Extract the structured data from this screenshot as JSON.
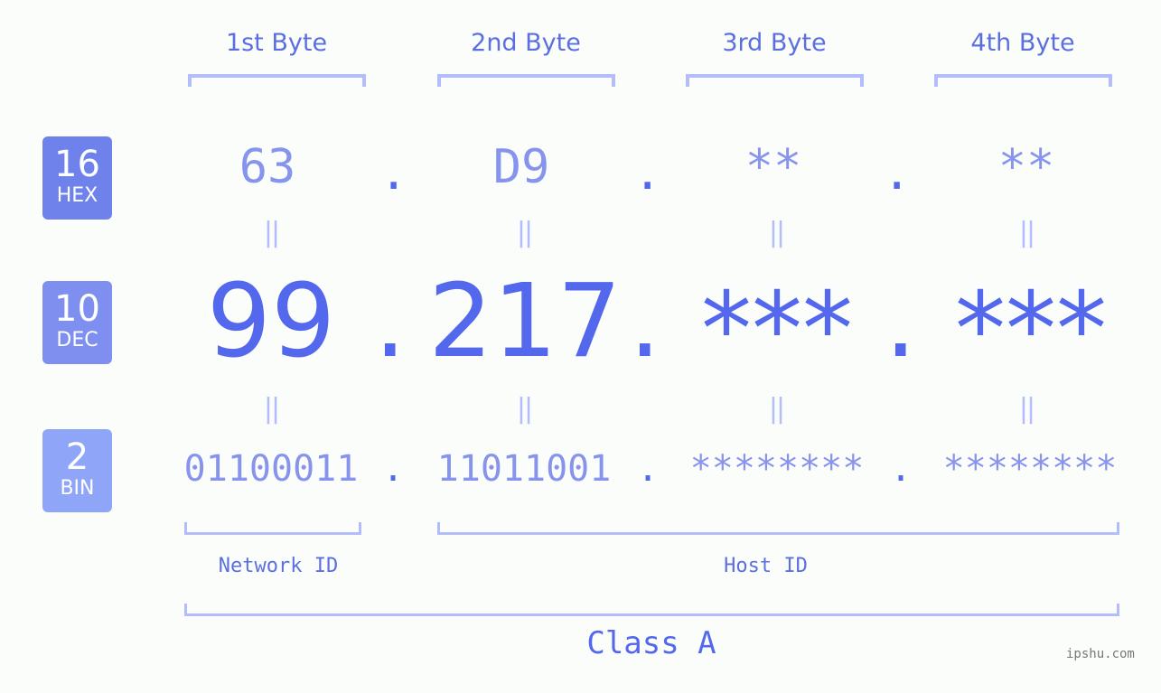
{
  "byte_headers": [
    "1st Byte",
    "2nd Byte",
    "3rd Byte",
    "4th Byte"
  ],
  "badges": {
    "hex": {
      "number": "16",
      "label": "HEX",
      "color": "#6f82ec"
    },
    "dec": {
      "number": "10",
      "label": "DEC",
      "color": "#7f8ff0"
    },
    "bin": {
      "number": "2",
      "label": "BIN",
      "color": "#8fa5f8"
    }
  },
  "hex_values": [
    "63",
    "D9",
    "**",
    "**"
  ],
  "dec_values": [
    "99",
    "217",
    "***",
    "***"
  ],
  "bin_values": [
    "01100011",
    "11011001",
    "********",
    "********"
  ],
  "separator": ".",
  "equals_symbol": "||",
  "network_id_label": "Network ID",
  "host_id_label": "Host ID",
  "class_label": "Class A",
  "watermark": "ipshu.com",
  "colors": {
    "primary": "#5468ee",
    "secondary": "#8694ee",
    "bracket": "#b3bdfb",
    "background": "#fbfdfb"
  }
}
